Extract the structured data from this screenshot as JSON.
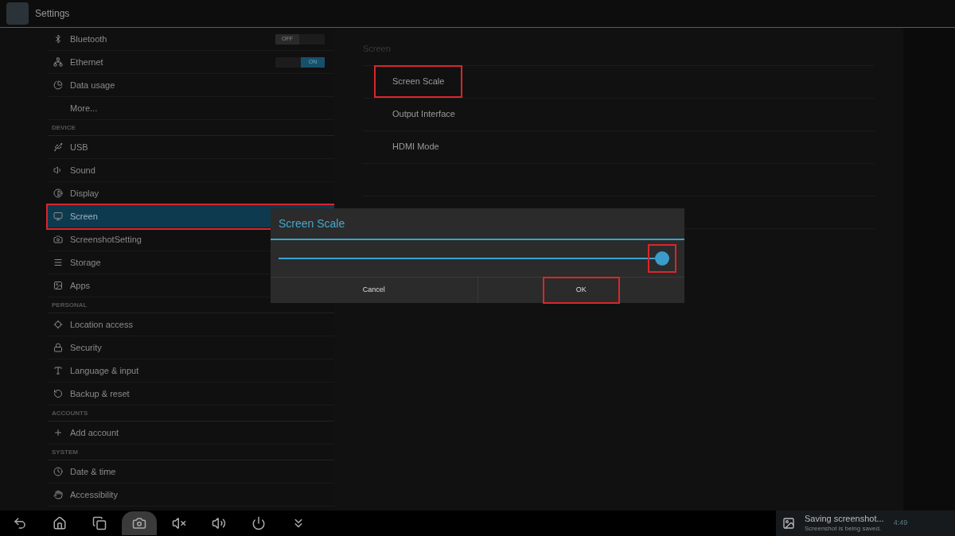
{
  "window": {
    "title": "Settings"
  },
  "sidebar": {
    "sections": [
      {
        "items": [
          {
            "label": "Bluetooth",
            "toggle": "OFF",
            "on": false,
            "selected": false,
            "highlighted": false
          },
          {
            "label": "Ethernet",
            "toggle": "ON",
            "on": true,
            "selected": false,
            "highlighted": false
          },
          {
            "label": "Data usage",
            "selected": false,
            "highlighted": false
          },
          {
            "label": "More...",
            "selected": false,
            "highlighted": false
          }
        ]
      },
      {
        "header": "DEVICE",
        "items": [
          {
            "label": "USB",
            "selected": false,
            "highlighted": false
          },
          {
            "label": "Sound",
            "selected": false,
            "highlighted": false
          },
          {
            "label": "Display",
            "selected": false,
            "highlighted": false
          },
          {
            "label": "Screen",
            "selected": true,
            "highlighted": true
          },
          {
            "label": "ScreenshotSetting",
            "selected": false,
            "highlighted": false
          },
          {
            "label": "Storage",
            "selected": false,
            "highlighted": false
          },
          {
            "label": "Apps",
            "selected": false,
            "highlighted": false
          }
        ]
      },
      {
        "header": "PERSONAL",
        "items": [
          {
            "label": "Location access",
            "selected": false,
            "highlighted": false
          },
          {
            "label": "Security",
            "selected": false,
            "highlighted": false
          },
          {
            "label": "Language & input",
            "selected": false,
            "highlighted": false
          },
          {
            "label": "Backup & reset",
            "selected": false,
            "highlighted": false
          }
        ]
      },
      {
        "header": "ACCOUNTS",
        "items": [
          {
            "label": "Add account",
            "selected": false,
            "highlighted": false
          }
        ]
      },
      {
        "header": "SYSTEM",
        "items": [
          {
            "label": "Date & time",
            "selected": false,
            "highlighted": false
          },
          {
            "label": "Accessibility",
            "selected": false,
            "highlighted": false
          }
        ]
      }
    ]
  },
  "detail": {
    "title": "Screen",
    "items": [
      {
        "label": "Screen Scale",
        "highlighted": true
      },
      {
        "label": "Output Interface",
        "highlighted": false
      },
      {
        "label": "HDMI Mode",
        "highlighted": false
      }
    ]
  },
  "dialog": {
    "title": "Screen Scale",
    "slider": {
      "level": 1,
      "highlighted": true
    },
    "buttons": [
      {
        "label": "Cancel",
        "highlighted": false
      },
      {
        "label": "OK",
        "highlighted": true
      }
    ]
  },
  "nav_buttons": [
    {
      "selected": false
    },
    {
      "selected": false
    },
    {
      "selected": false
    },
    {
      "selected": true
    },
    {
      "selected": false
    },
    {
      "selected": false
    },
    {
      "selected": false
    },
    {
      "selected": false
    }
  ],
  "notification": {
    "title": "Saving screenshot...",
    "text": "Screenshot is being saved.",
    "time": "4:49"
  }
}
